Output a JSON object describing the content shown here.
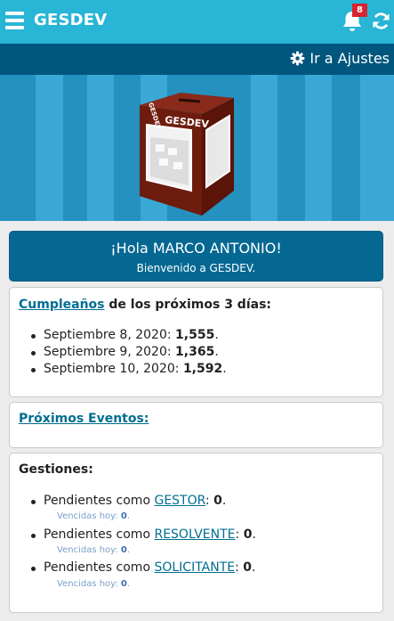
{
  "app": {
    "brand": "GESDEV",
    "notification_count": "8",
    "settings_label": "Ir a Ajustes",
    "banner_box_text": "GESDEV",
    "banner_box_side_text": "GESDEV"
  },
  "welcome": {
    "greeting": "¡Hola MARCO ANTONIO!",
    "subtitle": "Bienvenido a GESDEV."
  },
  "birthdays": {
    "link_text": "Cumpleaños",
    "title_rest": " de los próximos 3 días:",
    "items": [
      {
        "date": "Septiembre 8, 2020: ",
        "count": "1,555",
        "end": "."
      },
      {
        "date": "Septiembre 9, 2020: ",
        "count": "1,365",
        "end": "."
      },
      {
        "date": "Septiembre 10, 2020: ",
        "count": "1,592",
        "end": "."
      }
    ]
  },
  "events": {
    "link_text": "Próximos Eventos:"
  },
  "gestiones": {
    "title": "Gestiones:",
    "items": [
      {
        "prefix": "Pendientes como ",
        "role": "GESTOR",
        "sep": ": ",
        "count": "0",
        "end": ".",
        "overdue_label": "Vencidas hoy: ",
        "overdue_count": "0",
        "overdue_end": "."
      },
      {
        "prefix": "Pendientes como ",
        "role": "RESOLVENTE",
        "sep": ": ",
        "count": "0",
        "end": ".",
        "overdue_label": "Vencidas hoy: ",
        "overdue_count": "0",
        "overdue_end": "."
      },
      {
        "prefix": "Pendientes como ",
        "role": "SOLICITANTE",
        "sep": ": ",
        "count": "0",
        "end": ".",
        "overdue_label": "Vencidas hoy: ",
        "overdue_count": "0",
        "overdue_end": "."
      }
    ]
  },
  "icons": {
    "menu": "hamburger-icon",
    "notifications": "bell-icon",
    "refresh": "refresh-icon",
    "settings": "gear-icon"
  },
  "colors": {
    "topbar": "#28b5d6",
    "subbar": "#00567d",
    "welcome_card": "#046892",
    "link": "#006e91",
    "badge": "#d9232d"
  }
}
